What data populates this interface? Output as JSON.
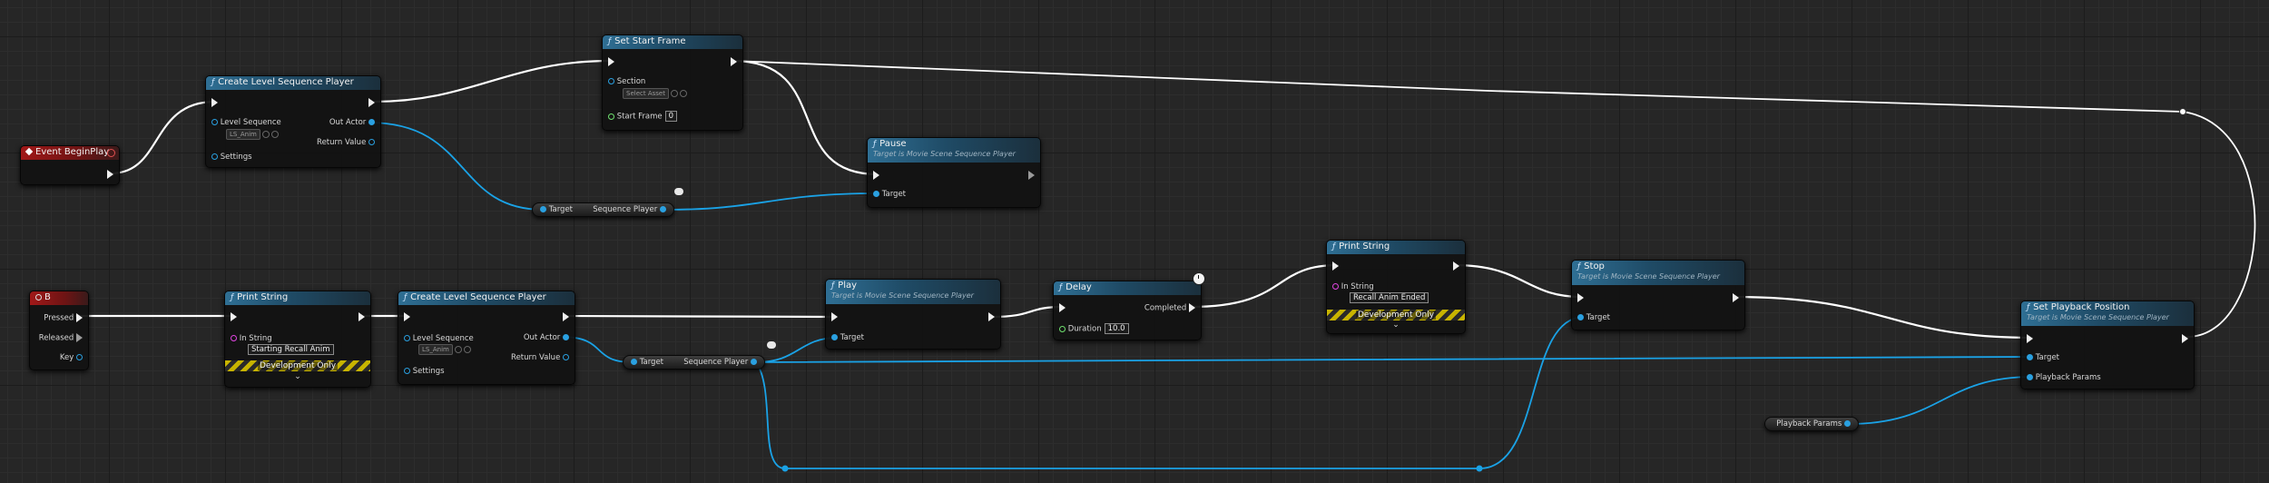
{
  "colors": {
    "exec_wire": "#ffffff",
    "data_wire": "#1aa2e6",
    "function_header": "#2f6f94",
    "event_header": "#a01818"
  },
  "nodes": {
    "event_begin_play": {
      "title": "Event BeginPlay"
    },
    "create_lsp_1": {
      "title": "Create Level Sequence Player",
      "level_sequence_label": "Level Sequence",
      "level_sequence_value": "LS_Anim",
      "settings_label": "Settings",
      "out_actor_label": "Out Actor",
      "return_value_label": "Return Value"
    },
    "set_start_frame": {
      "title": "Set Start Frame",
      "section_label": "Section",
      "section_value": "Select Asset",
      "start_frame_label": "Start Frame",
      "start_frame_value": "0"
    },
    "pause": {
      "title": "Pause",
      "subtitle": "Target is Movie Scene Sequence Player",
      "target_label": "Target"
    },
    "var_seq_player_1": {
      "target_label": "Target",
      "name": "Sequence Player"
    },
    "key_b": {
      "title": "B",
      "pressed_label": "Pressed",
      "released_label": "Released",
      "key_label": "Key"
    },
    "print_string_1": {
      "title": "Print String",
      "in_string_label": "In String",
      "in_string_value": "Starting Recall Anim",
      "dev_label": "Development Only"
    },
    "create_lsp_2": {
      "title": "Create Level Sequence Player",
      "level_sequence_label": "Level Sequence",
      "level_sequence_value": "LS_Anim",
      "settings_label": "Settings",
      "out_actor_label": "Out Actor",
      "return_value_label": "Return Value"
    },
    "var_seq_player_2": {
      "target_label": "Target",
      "name": "Sequence Player"
    },
    "play": {
      "title": "Play",
      "subtitle": "Target is Movie Scene Sequence Player",
      "target_label": "Target"
    },
    "delay": {
      "title": "Delay",
      "completed_label": "Completed",
      "duration_label": "Duration",
      "duration_value": "10.0"
    },
    "print_string_2": {
      "title": "Print String",
      "in_string_label": "In String",
      "in_string_value": "Recall Anim Ended",
      "dev_label": "Development Only"
    },
    "stop": {
      "title": "Stop",
      "subtitle": "Target is Movie Scene Sequence Player",
      "target_label": "Target"
    },
    "set_playback_position": {
      "title": "Set Playback Position",
      "subtitle": "Target is Movie Scene Sequence Player",
      "target_label": "Target",
      "playback_params_label": "Playback Params"
    },
    "var_playback_params": {
      "name": "Playback Params"
    }
  }
}
